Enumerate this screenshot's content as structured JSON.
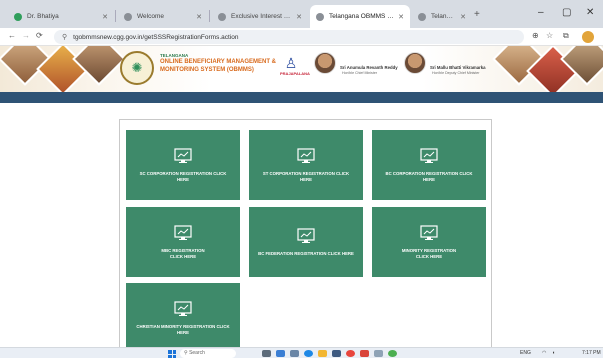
{
  "browser": {
    "tabs": [
      {
        "title": "Dr. Bhatiya",
        "active": false,
        "color": "#2f9e5b"
      },
      {
        "title": "Welcome",
        "active": false,
        "color": "#8a8f96"
      },
      {
        "title": "Exclusive Interest Rate",
        "active": false,
        "color": "#8a8f96"
      },
      {
        "title": "Telangana OBMMS - Online",
        "active": true,
        "color": "#8a8f96"
      },
      {
        "title": "Telangana Rajeev",
        "active": false,
        "color": "#8a8f96"
      }
    ],
    "new_tab": "+",
    "window_controls": {
      "minimize": "–",
      "maximize": "▢",
      "close": "✕"
    },
    "url": "tgobmmsnew.cgg.gov.in/getSSSRegistrationForms.action",
    "nav_icons": {
      "back": "←",
      "forward": "→",
      "reload": "⟳"
    },
    "toolbar_icons": [
      "zoom-icon",
      "star-icon",
      "extensions-icon"
    ]
  },
  "header": {
    "state": "TELANGANA",
    "title_line1": "ONLINE BENEFICIARY MANAGEMENT &",
    "title_line2": "MONITORING SYSTEM (OBMMS)",
    "logo2_text": "PRAJAPALANA",
    "person1_name": "Sri Anumula Revanth Reddy",
    "person1_title": "Hon'ble Chief Minister",
    "person2_name": "Sri Mallu Bhatti Vikramarka",
    "person2_title": "Hon'ble Deputy Chief Minister"
  },
  "cards": [
    {
      "label": "SC CORPORATION REGISTRATION CLICK HERE"
    },
    {
      "label": "ST CORPORATION REGISTRATION CLICK HERE"
    },
    {
      "label": "BC CORPORATION REGISTRATION CLICK HERE"
    },
    {
      "label_line1": "MBC REGISTRATION",
      "label_line2": "CLICK HERE"
    },
    {
      "label": "BC FEDERATION REGISTRATION CLICK HERE"
    },
    {
      "label_line1": "MINORITY REGISTRATION",
      "label_line2": "CLICK HERE"
    },
    {
      "label_line1": "CHRISTIAN MINORITY REGISTRATION CLICK",
      "label_line2": "HERE"
    }
  ],
  "colors": {
    "card": "#3e8a6a",
    "navbar": "#2f5375",
    "brand_orange": "#d86a1d"
  },
  "taskbar": {
    "search_placeholder": "Search",
    "lang": "ENG",
    "time": "7:17 PM"
  }
}
